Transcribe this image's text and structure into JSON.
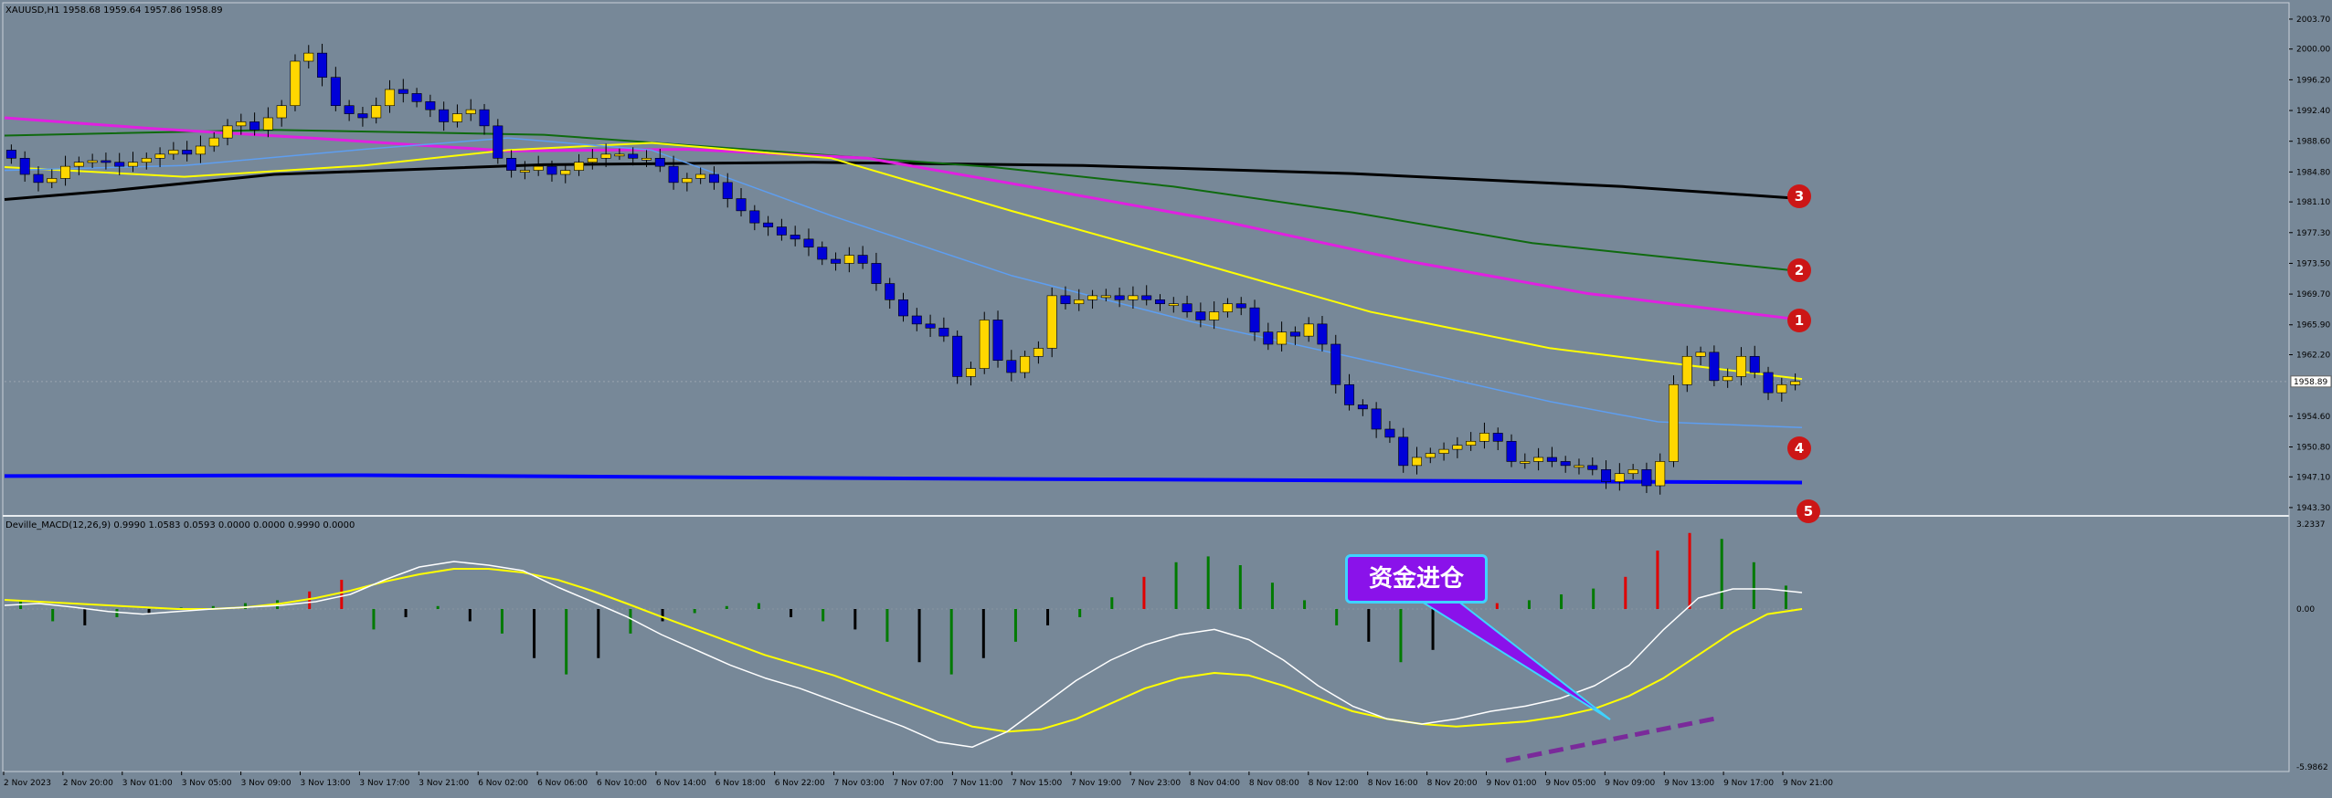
{
  "window": {
    "symbol_info": "XAUUSD,H1  1958.68 1959.64 1957.86 1958.89",
    "price_marker": "1958.89"
  },
  "indicator": {
    "title": "Deville_MACD(12,26,9) 0.9990 1.0583 0.0593 0.0000 0.0000 0.9990 0.0000",
    "axis_labels": [
      "3.2337",
      "0.00",
      "-5.9862"
    ]
  },
  "annotations": {
    "callout_text": "资金进仓",
    "badges": [
      "3",
      "2",
      "1",
      "4",
      "5"
    ]
  },
  "colors": {
    "background": "#778898",
    "bull_candle": "#ffd700",
    "bear_candle": "#0000d8",
    "ma_black": "#000000",
    "ma_green": "#0f6a0f",
    "ma_magenta": "#e020e0",
    "ma_yellow": "#ffff00",
    "ma_lightblue": "#5e9ef0",
    "support_blue": "#0000ff",
    "macd_white": "#ffffff",
    "macd_signal": "#ffff00",
    "hist_green": "#007a00",
    "hist_red": "#e00000",
    "hist_black": "#000000"
  },
  "chart_data": [
    {
      "type": "candlestick",
      "symbol": "XAUUSD",
      "timeframe": "H1",
      "y_axis_ticks": [
        "2003.70",
        "2000.00",
        "1996.20",
        "1992.40",
        "1988.60",
        "1984.80",
        "1981.10",
        "1977.30",
        "1973.50",
        "1969.70",
        "1965.90",
        "1962.20",
        "1958.89",
        "1954.60",
        "1950.80",
        "1947.10",
        "1943.30"
      ],
      "ylim": [
        1942.5,
        2005.5
      ],
      "x_axis_labels": [
        "2 Nov 2023",
        "2 Nov 20:00",
        "3 Nov 01:00",
        "3 Nov 05:00",
        "3 Nov 09:00",
        "3 Nov 13:00",
        "3 Nov 17:00",
        "3 Nov 21:00",
        "6 Nov 02:00",
        "6 Nov 06:00",
        "6 Nov 10:00",
        "6 Nov 14:00",
        "6 Nov 18:00",
        "6 Nov 22:00",
        "7 Nov 03:00",
        "7 Nov 07:00",
        "7 Nov 11:00",
        "7 Nov 15:00",
        "7 Nov 19:00",
        "7 Nov 23:00",
        "8 Nov 04:00",
        "8 Nov 08:00",
        "8 Nov 12:00",
        "8 Nov 16:00",
        "8 Nov 20:00",
        "9 Nov 01:00",
        "9 Nov 05:00",
        "9 Nov 09:00",
        "9 Nov 13:00",
        "9 Nov 17:00",
        "9 Nov 21:00"
      ],
      "close_path": [
        1986.5,
        1984.5,
        1983.5,
        1984.0,
        1985.5,
        1986.0,
        1986.2,
        1986.0,
        1985.5,
        1986.0,
        1986.5,
        1987.0,
        1987.5,
        1987.0,
        1988.0,
        1989.0,
        1990.5,
        1991.0,
        1990.0,
        1991.5,
        1993.0,
        1998.5,
        1999.5,
        1996.5,
        1993.0,
        1992.0,
        1991.5,
        1993.0,
        1995.0,
        1994.5,
        1993.5,
        1992.5,
        1991.0,
        1992.0,
        1992.5,
        1990.5,
        1986.5,
        1985.0,
        1985.0,
        1985.5,
        1984.5,
        1985.0,
        1986.0,
        1986.5,
        1987.0,
        1987.0,
        1986.5,
        1986.5,
        1985.5,
        1983.5,
        1984.0,
        1984.5,
        1983.5,
        1981.5,
        1980.0,
        1978.5,
        1978.0,
        1977.0,
        1976.5,
        1975.5,
        1974.0,
        1973.5,
        1974.5,
        1973.5,
        1971.0,
        1969.0,
        1967.0,
        1966.0,
        1965.5,
        1964.5,
        1959.5,
        1960.5,
        1966.5,
        1961.5,
        1960.0,
        1962.0,
        1963.0,
        1969.5,
        1968.5,
        1969.0,
        1969.5,
        1969.5,
        1969.0,
        1969.5,
        1969.0,
        1968.5,
        1968.5,
        1967.5,
        1966.5,
        1967.5,
        1968.5,
        1968.0,
        1965.0,
        1963.5,
        1965.0,
        1964.5,
        1966.0,
        1963.5,
        1958.5,
        1956.0,
        1955.5,
        1953.0,
        1952.0,
        1948.5,
        1949.5,
        1950.0,
        1950.5,
        1951.0,
        1951.5,
        1952.5,
        1951.5,
        1949.0,
        1949.0,
        1949.5,
        1949.0,
        1948.5,
        1948.5,
        1948.0,
        1946.5,
        1947.5,
        1948.0,
        1946.0,
        1949.0,
        1958.5,
        1962.0,
        1962.5,
        1959.0,
        1959.5,
        1962.0,
        1960.0,
        1957.5,
        1958.5,
        1958.89
      ]
    },
    {
      "type": "line",
      "name": "Deville_MACD(12,26,9)",
      "ylim": [
        -5.9862,
        3.2337
      ],
      "macd": [
        0.2,
        0.3,
        0.1,
        -0.1,
        -0.2,
        -0.1,
        0,
        0.1,
        0.2,
        0.4,
        0.8,
        1.6,
        2.3,
        2.6,
        2.4,
        2.1,
        1.2,
        0.4,
        -0.3,
        -1.0,
        -1.6,
        -2.2,
        -2.7,
        -3.1,
        -3.6,
        -4.1,
        -4.6,
        -5.2,
        -5.4,
        -4.8,
        -3.8,
        -2.8,
        -2.0,
        -1.4,
        -1.0,
        -0.8,
        -1.2,
        -2.0,
        -3.0,
        -3.8,
        -4.3,
        -4.5,
        -4.3,
        -4.0,
        -3.8,
        -3.5,
        -3.0,
        -2.2,
        -0.8,
        0.6,
        1.1,
        1.1,
        0.9
      ],
      "signal": [
        0.5,
        0.4,
        0.3,
        0.2,
        0.1,
        0,
        0,
        0.1,
        0.3,
        0.6,
        1.0,
        1.5,
        1.9,
        2.2,
        2.2,
        2.0,
        1.6,
        1.0,
        0.3,
        -0.3,
        -0.8,
        -1.3,
        -1.8,
        -2.2,
        -2.6,
        -3.1,
        -3.6,
        -4.1,
        -4.6,
        -4.8,
        -4.7,
        -4.3,
        -3.7,
        -3.1,
        -2.7,
        -2.5,
        -2.6,
        -3.0,
        -3.5,
        -4.0,
        -4.3,
        -4.5,
        -4.6,
        -4.5,
        -4.4,
        -4.2,
        -3.9,
        -3.4,
        -2.7,
        -1.8,
        -0.9,
        -0.2,
        0.0
      ],
      "histogram": [
        0.3,
        -0.3,
        -0.4,
        -0.2,
        -0.1,
        0.05,
        0.1,
        0.2,
        0.3,
        0.6,
        1.0,
        -0.5,
        -0.2,
        0.1,
        -0.3,
        -0.6,
        -1.2,
        -1.6,
        -1.2,
        -0.6,
        -0.3,
        -0.1,
        0.1,
        0.2,
        -0.2,
        -0.3,
        -0.5,
        -0.8,
        -1.3,
        -1.6,
        -1.2,
        -0.8,
        -0.4,
        -0.2,
        0.4,
        1.1,
        1.6,
        1.8,
        1.5,
        0.9,
        0.3,
        -0.4,
        -0.8,
        -1.3,
        -1.0,
        -0.3,
        0.2,
        0.3,
        0.5,
        0.7,
        1.1,
        2.0,
        2.6,
        2.4,
        1.6,
        0.8
      ]
    }
  ]
}
